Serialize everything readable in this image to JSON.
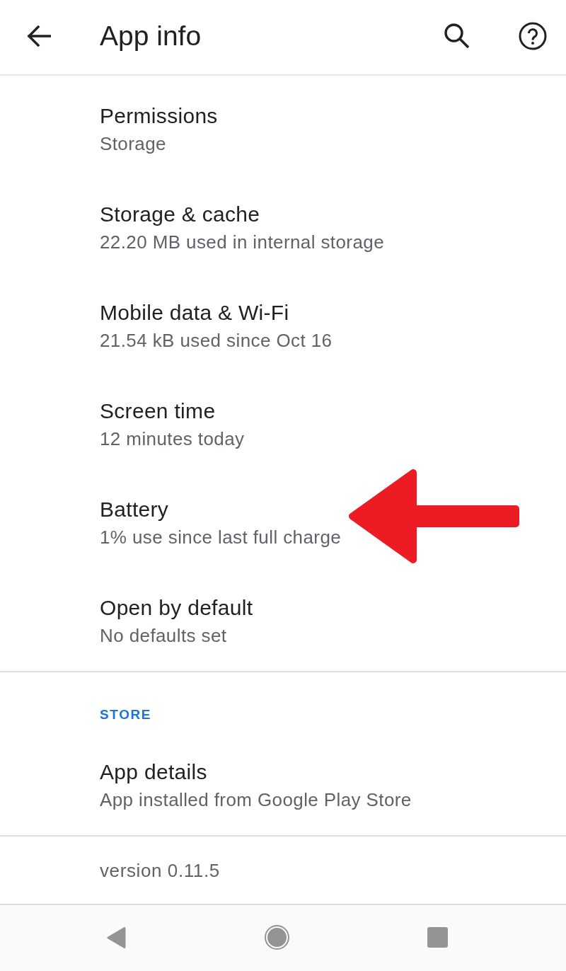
{
  "app_bar": {
    "title": "App info"
  },
  "items": [
    {
      "title": "Permissions",
      "summary": "Storage",
      "highlighted": false
    },
    {
      "title": "Storage & cache",
      "summary": "22.20 MB used in internal storage",
      "highlighted": false
    },
    {
      "title": "Mobile data & Wi-Fi",
      "summary": "21.54 kB used since Oct 16",
      "highlighted": false
    },
    {
      "title": "Screen time",
      "summary": "12 minutes today",
      "highlighted": false
    },
    {
      "title": "Battery",
      "summary": "1% use since last full charge",
      "highlighted": true
    },
    {
      "title": "Open by default",
      "summary": "No defaults set",
      "highlighted": false
    }
  ],
  "sections": [
    {
      "header": "STORE",
      "items": [
        {
          "title": "App details",
          "summary": "App installed from Google Play Store",
          "highlighted": false
        }
      ]
    }
  ],
  "footer": {
    "version": "version 0.11.5"
  }
}
